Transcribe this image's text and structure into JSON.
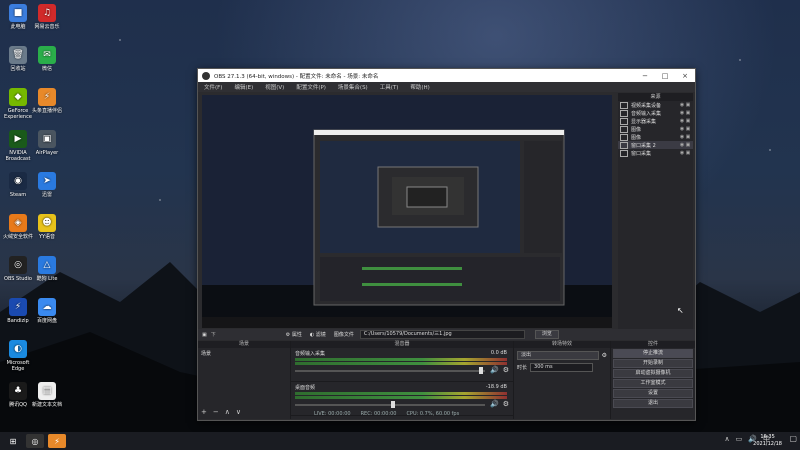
{
  "desktop": {
    "icons": [
      {
        "label": "此电脑",
        "glyph": "■",
        "color": "#3b7ddd"
      },
      {
        "label": "网易云音乐",
        "glyph": "♫",
        "color": "#d12a2a"
      },
      {
        "label": "回收站",
        "glyph": "🗑",
        "color": "#6a7a8a"
      },
      {
        "label": "微信",
        "glyph": "✉",
        "color": "#2aae4a"
      },
      {
        "label": "GeForce Experience",
        "glyph": "◆",
        "color": "#76b900"
      },
      {
        "label": "头条直播伴侣",
        "glyph": "⚡",
        "color": "#e8892a"
      },
      {
        "label": "NVIDIA Broadcast",
        "glyph": "▶",
        "color": "#1a5a1a"
      },
      {
        "label": "AirPlayer",
        "glyph": "▣",
        "color": "#4a5560"
      },
      {
        "label": "Steam",
        "glyph": "◉",
        "color": "#1a2a44"
      },
      {
        "label": "迅雷",
        "glyph": "➤",
        "color": "#2a7ae0"
      },
      {
        "label": "火绒安全软件",
        "glyph": "◈",
        "color": "#e87a1a"
      },
      {
        "label": "YY语音",
        "glyph": "☻",
        "color": "#e8c21a"
      },
      {
        "label": "OBS Studio",
        "glyph": "◎",
        "color": "#222"
      },
      {
        "label": "酷狗 Lite",
        "glyph": "△",
        "color": "#2a7ae0"
      },
      {
        "label": "Bandizip",
        "glyph": "⚡",
        "color": "#1a4ab0"
      },
      {
        "label": "百度网盘",
        "glyph": "☁",
        "color": "#3a8af0"
      },
      {
        "label": "Microsoft Edge",
        "glyph": "◐",
        "color": "#1a8ae0"
      },
      {
        "label": "",
        "glyph": "",
        "color": "transparent"
      },
      {
        "label": "腾讯QQ",
        "glyph": "♣",
        "color": "#1a1a1a"
      },
      {
        "label": "新建文本文档",
        "glyph": "▤",
        "color": "#eeeeee"
      }
    ]
  },
  "window": {
    "title": "OBS 27.1.3 (64-bit, windows) - 配置文件: 未命名 - 场景: 未命名",
    "menus": [
      "文件(F)",
      "编辑(E)",
      "视图(V)",
      "配置文件(P)",
      "场景集合(S)",
      "工具(T)",
      "帮助(H)"
    ],
    "sources_header": "来源",
    "sources": [
      {
        "name": "视频采集设备",
        "sel": false
      },
      {
        "name": "音频输入采集",
        "sel": false
      },
      {
        "name": "显示器采集",
        "sel": false
      },
      {
        "name": "图像",
        "sel": false
      },
      {
        "name": "图像",
        "sel": false
      },
      {
        "name": "窗口采集 2",
        "sel": true
      },
      {
        "name": "窗口采集",
        "sel": false
      }
    ],
    "controls": {
      "props": "属性",
      "filters": "滤镜",
      "image_file_label": "图像文件",
      "image_path": "C:/Users/10579/Documents/三1.jpg",
      "browse": "浏览"
    },
    "scenes_header": "场景",
    "scenes": [
      "场景"
    ],
    "mixer_header": "混音器",
    "mixer": [
      {
        "name": "音频输入采集",
        "db": "0.0 dB"
      },
      {
        "name": "桌面音频",
        "db": "-18.9 dB"
      }
    ],
    "transitions_header": "转场特效",
    "transition": "淡出",
    "duration_label": "时长",
    "duration": "300 ms",
    "controls_header": "控件",
    "control_buttons": [
      "停止推流",
      "开始录制",
      "启动虚拟摄像机",
      "工作室模式",
      "设置",
      "退出"
    ],
    "status": {
      "live": "LIVE: 00:00:00",
      "rec": "REC: 00:00:00",
      "cpu": "CPU: 0.7%, 60.00 fps"
    }
  },
  "taskbar": {
    "time": "16:35",
    "date": "2021/12/18"
  },
  "colors": {
    "accent": "#3a4a6a"
  }
}
